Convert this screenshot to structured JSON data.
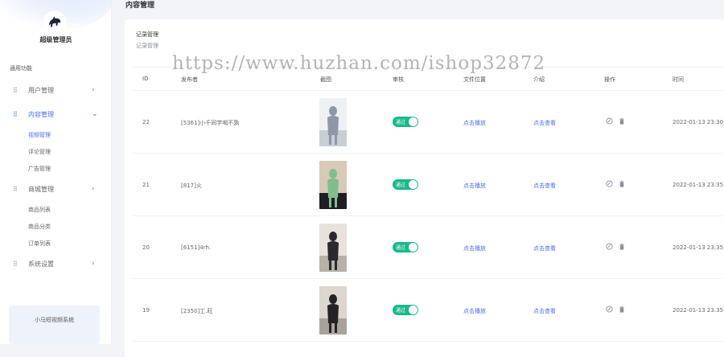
{
  "sidebar": {
    "admin_name": "超级管理员",
    "section_label": "通用功能",
    "menus": [
      {
        "label": "用户管理",
        "icon": "grid-icon",
        "arrow": "›",
        "expanded": false
      },
      {
        "label": "内容管理",
        "icon": "grid-icon",
        "arrow": "⌄",
        "expanded": true,
        "children": [
          "视频管理",
          "评论管理",
          "广告管理"
        ]
      },
      {
        "label": "商城管理",
        "icon": "grid-icon",
        "arrow": "›",
        "expanded": false
      },
      {
        "label": "商品列表"
      },
      {
        "label": "商品分类"
      },
      {
        "label": "订单列表"
      },
      {
        "label": "系统设置",
        "icon": "grid-icon",
        "arrow": "›",
        "expanded": false
      }
    ],
    "system_card": "小马短视频系统"
  },
  "page": {
    "title": "内容管理",
    "card_title": "记录管理",
    "card_sub": "记录管理"
  },
  "table": {
    "headers": [
      "ID",
      "发布者",
      "截图",
      "审核",
      "文件位置",
      "介绍",
      "操作",
      "时间"
    ],
    "rows": [
      {
        "id": "22",
        "publisher": "[5361]小千同学喝不孰",
        "status": "通过",
        "file": "点击播放",
        "intro": "点击查看",
        "time": "2022-01-13 23:30",
        "thumb_colors": [
          "#c9ced6",
          "#8e97a5",
          "#eef0f2"
        ]
      },
      {
        "id": "21",
        "publisher": "[817]火",
        "status": "通过",
        "file": "点击播放",
        "intro": "点击查看",
        "time": "2022-01-13 23:35",
        "thumb_colors": [
          "#1d1d22",
          "#7fbf8e",
          "#d9c9b9"
        ]
      },
      {
        "id": "20",
        "publisher": "[6151]4rh.",
        "status": "通过",
        "file": "点击播放",
        "intro": "点击查看",
        "time": "2022-01-13 23:35",
        "thumb_colors": [
          "#b7b1a8",
          "#2a2a2e",
          "#e7e2dc"
        ]
      },
      {
        "id": "19",
        "publisher": "[2350]工.旺",
        "status": "通过",
        "file": "点击播放",
        "intro": "点击查看",
        "time": "2022-01-13 23:35",
        "thumb_colors": [
          "#a7a29c",
          "#232326",
          "#dcd6cf"
        ]
      }
    ]
  },
  "icons": {
    "edit": "edit-icon",
    "delete": "trash-icon"
  },
  "colors": {
    "accent": "#4e6ef2",
    "toggle_on": "#19b98a"
  },
  "watermark": "https://www.huzhan.com/ishop32872"
}
